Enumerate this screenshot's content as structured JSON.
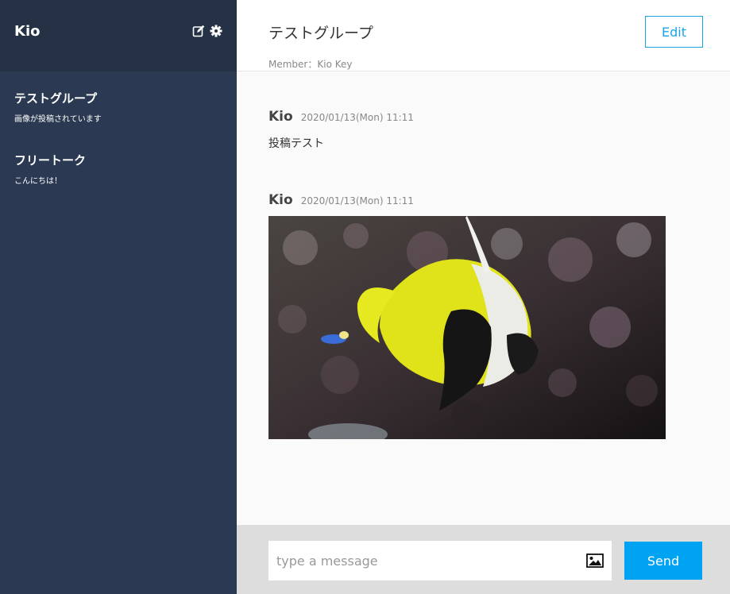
{
  "sidebar": {
    "user_name": "Kio",
    "icons": [
      "edit-icon",
      "gear-icon"
    ],
    "groups": [
      {
        "name": "テストグループ",
        "last_message": "画像が投稿されています"
      },
      {
        "name": "フリートーク",
        "last_message": "こんにちは！"
      }
    ]
  },
  "header": {
    "group_title": "テストグループ",
    "members": "Member：Kio Key",
    "edit_label": "Edit"
  },
  "messages": [
    {
      "user": "Kio",
      "date": "2020/01/13(Mon) 11:11",
      "text": "投稿テスト"
    },
    {
      "user": "Kio",
      "date": "2020/01/13(Mon) 11:11",
      "image": "bannerfish-photo"
    }
  ],
  "form": {
    "placeholder": "type a message",
    "send_label": "Send",
    "image_icon": "image-icon"
  },
  "colors": {
    "sidebar_bg": "#2b3a52",
    "sidebar_header_bg": "#253246",
    "accent": "#1aa3e8",
    "send_bg": "#00a2f2"
  }
}
